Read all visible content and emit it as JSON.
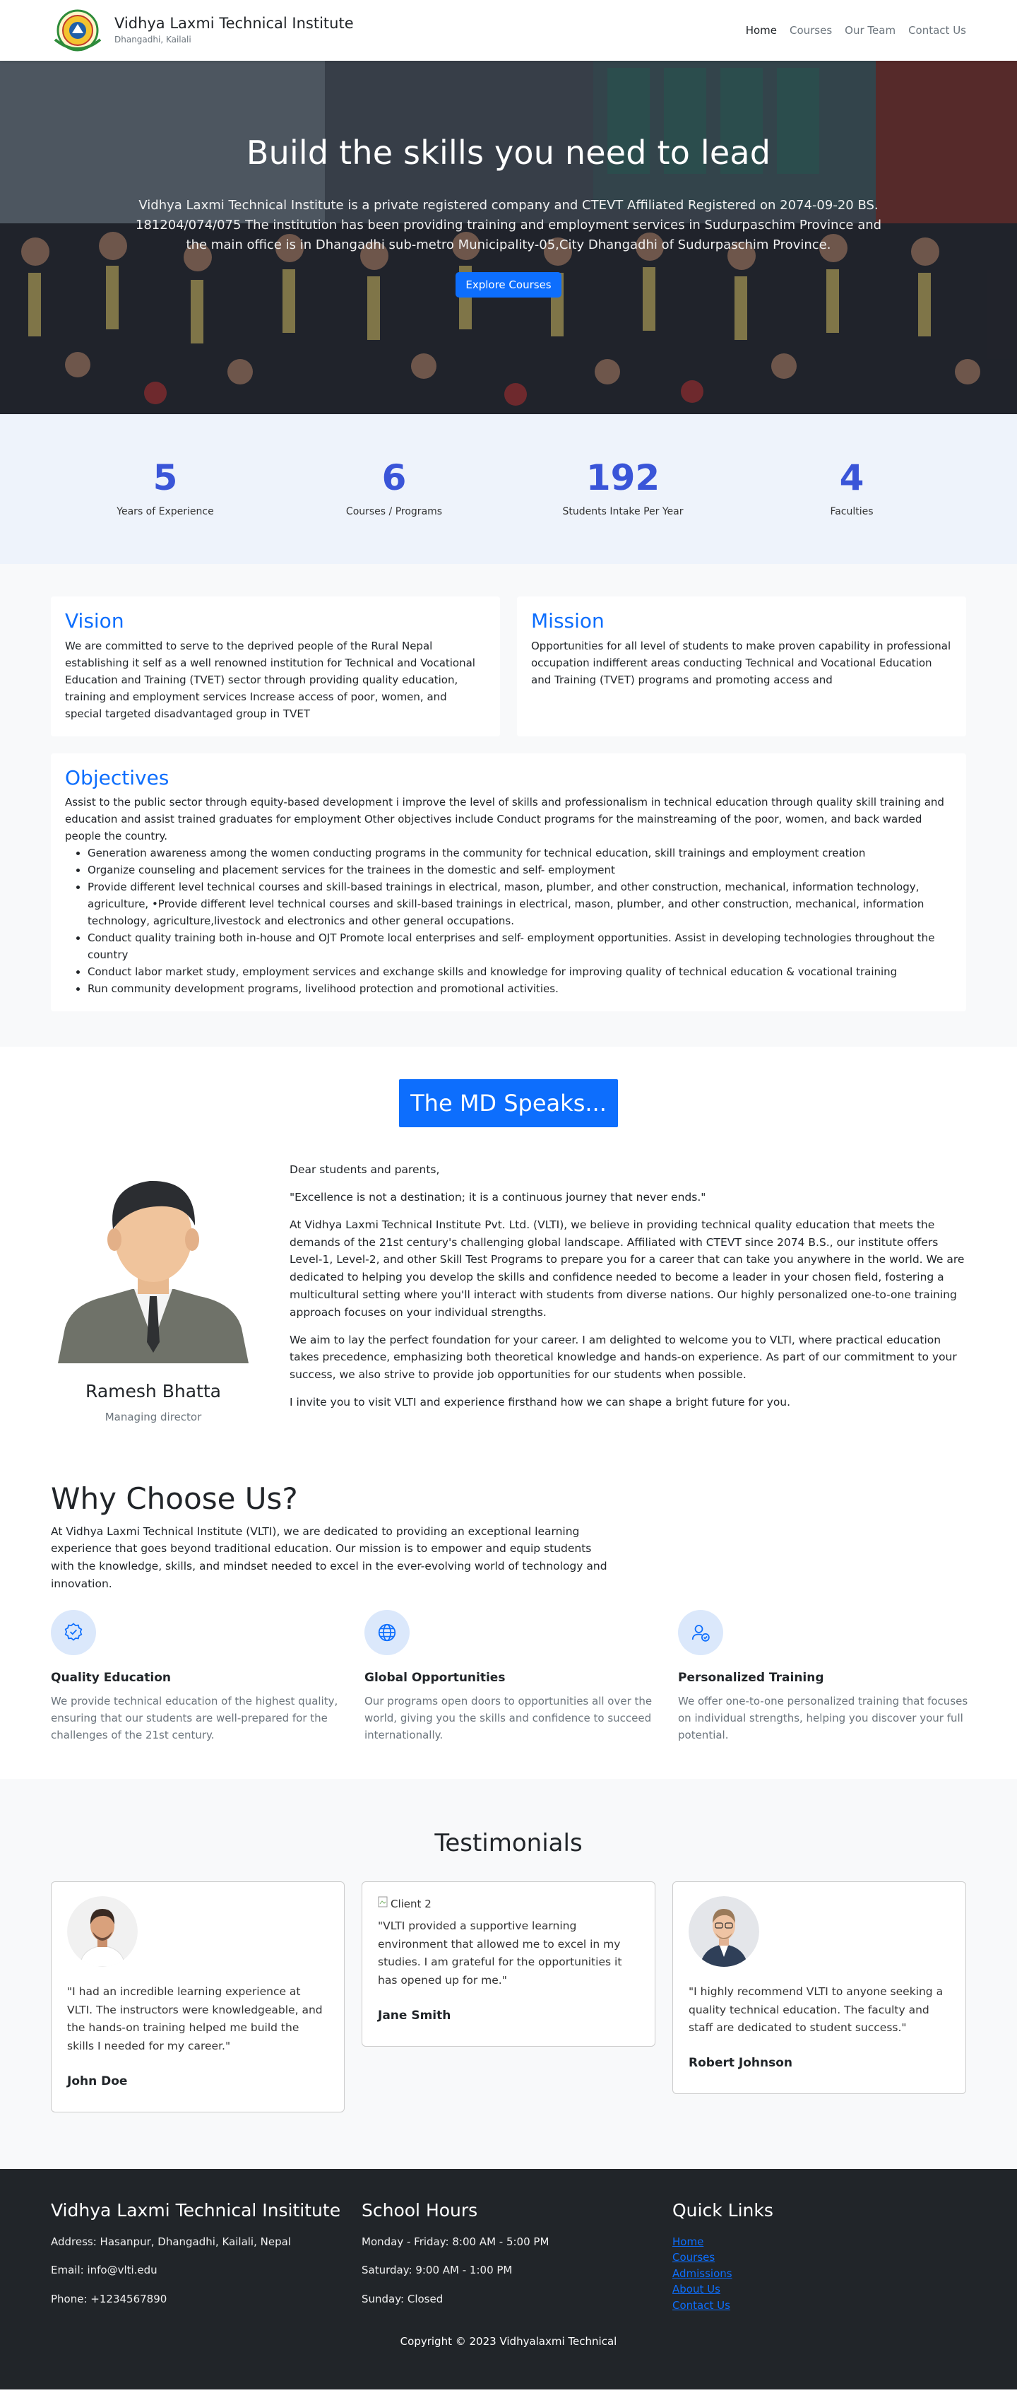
{
  "nav": {
    "brand_name": "Vidhya Laxmi Technical Institute",
    "brand_sub": "Dhangadhi, Kailali",
    "links": [
      "Home",
      "Courses",
      "Our Team",
      "Contact Us"
    ]
  },
  "hero": {
    "title": "Build the skills you need to lead",
    "text": "Vidhya Laxmi Technical Institute is a private registered company and CTEVT Affiliated Registered on 2074-09-20 BS. 181204/074/075 The institution has been providing training and employment services in Sudurpaschim Province and the main office is in Dhangadhi sub-metro Municipality-05,City Dhangadhi of Sudurpaschim Province.",
    "button": "Explore Courses"
  },
  "stats": [
    {
      "num": "5",
      "label": "Years of Experience"
    },
    {
      "num": "6",
      "label": "Courses / Programs"
    },
    {
      "num": "192",
      "label": "Students Intake Per Year"
    },
    {
      "num": "4",
      "label": "Faculties"
    }
  ],
  "vision": {
    "title": "Vision",
    "text": "We are committed to serve to the deprived people of the Rural Nepal establishing it self as a well renowned institution for Technical and Vocational Education and Training (TVET) sector through providing quality education, training and employment services Increase access of poor, women, and special targeted disadvantaged group in TVET"
  },
  "mission": {
    "title": "Mission",
    "text": "Opportunities for all level of students to make proven capability in professional occupation indifferent areas conducting Technical and Vocational Education and Training (TVET) programs and promoting access and"
  },
  "objectives": {
    "title": "Objectives",
    "intro": "Assist to the public sector through equity-based development i improve the level of skills and professionalism in technical education through quality skill training and education and assist trained graduates for employment Other objectives include Conduct programs for the mainstreaming of the poor, women, and back warded people the country.",
    "items": [
      "Generation awareness among the women conducting programs in the community for technical education, skill trainings and employment creation",
      "Organize counseling and placement services for the trainees in the domestic and self- employment",
      "Provide different level technical courses and skill-based trainings in electrical, mason, plumber, and other construction, mechanical, information technology, agriculture, •Provide different level technical courses and skill-based trainings in electrical, mason, plumber, and other construction, mechanical, information technology, agriculture,livestock and electronics and other general occupations.",
      "Conduct quality training both in-house and OJT Promote local enterprises and self- employment opportunities. Assist in developing technologies throughout the country",
      "Conduct labor market study, employment services and exchange skills and knowledge for improving quality of technical education & vocational training",
      "Run community development programs, livelihood protection and promotional activities."
    ]
  },
  "md": {
    "heading": "The MD Speaks...",
    "name": "Ramesh Bhatta",
    "role": "Managing director",
    "paragraphs": [
      "Dear students and parents,",
      "\"Excellence is not a destination; it is a continuous journey that never ends.\"",
      "At Vidhya Laxmi Technical Institute Pvt. Ltd. (VLTI), we believe in providing technical quality education that meets the demands of the 21st century's challenging global landscape. Affiliated with CTEVT since 2074 B.S., our institute offers Level-1, Level-2, and other Skill Test Programs to prepare you for a career that can take you anywhere in the world. We are dedicated to helping you develop the skills and confidence needed to become a leader in your chosen field, fostering a multicultural setting where you'll interact with students from diverse nations. Our highly personalized one-to-one training approach focuses on your individual strengths.",
      "We aim to lay the perfect foundation for your career. I am delighted to welcome you to VLTI, where practical education takes precedence, emphasizing both theoretical knowledge and hands-on experience. As part of our commitment to your success, we also strive to provide job opportunities for our students when possible.",
      "I invite you to visit VLTI and experience firsthand how we can shape a bright future for you."
    ]
  },
  "why": {
    "title": "Why Choose Us?",
    "intro": "At Vidhya Laxmi Technical Institute (VLTI), we are dedicated to providing an exceptional learning experience that goes beyond traditional education. Our mission is to empower and equip students with the knowledge, skills, and mindset needed to excel in the ever-evolving world of technology and innovation.",
    "features": [
      {
        "icon": "badge-check-icon",
        "title": "Quality Education",
        "text": "We provide technical education of the highest quality, ensuring that our students are well-prepared for the challenges of the 21st century."
      },
      {
        "icon": "globe-icon",
        "title": "Global Opportunities",
        "text": "Our programs open doors to opportunities all over the world, giving you the skills and confidence to succeed internationally."
      },
      {
        "icon": "user-check-icon",
        "title": "Personalized Training",
        "text": "We offer one-to-one personalized training that focuses on individual strengths, helping you discover your full potential."
      }
    ],
    "accent": "#0d6efd"
  },
  "testimonials": {
    "title": "Testimonials",
    "items": [
      {
        "name": "John Doe",
        "quote": "\"I had an incredible learning experience at VLTI. The instructors were knowledgeable, and the hands-on training helped me build the skills I needed for my career.\""
      },
      {
        "name": "Jane Smith",
        "alt": "Client 2",
        "quote": "\"VLTI provided a supportive learning environment that allowed me to excel in my studies. I am grateful for the opportunities it has opened up for me.\""
      },
      {
        "name": "Robert Johnson",
        "quote": "\"I highly recommend VLTI to anyone seeking a quality technical education. The faculty and staff are dedicated to student success.\""
      }
    ]
  },
  "footer": {
    "col1": {
      "title": "Vidhya Laxmi Technical Insititute",
      "address": "Address: Hasanpur, Dhangadhi, Kailali, Nepal",
      "email": "Email: info@vlti.edu",
      "phone": "Phone: +1234567890"
    },
    "col2": {
      "title": "School Hours",
      "weekday": "Monday - Friday: 8:00 AM - 5:00 PM",
      "saturday": "Saturday: 9:00 AM - 1:00 PM",
      "sunday": "Sunday: Closed"
    },
    "col3": {
      "title": "Quick Links",
      "links": [
        "Home",
        "Courses",
        "Admissions",
        "About Us",
        "Contact Us"
      ]
    },
    "copyright": "Copyright © 2023 Vidhyalaxmi Technical"
  }
}
